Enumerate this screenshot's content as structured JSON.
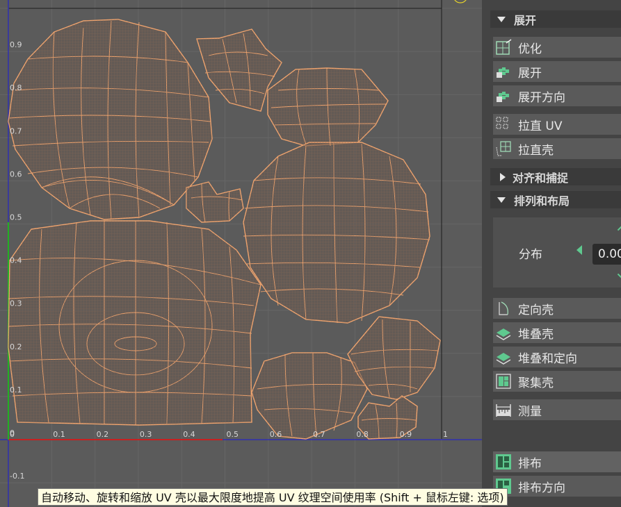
{
  "viewport": {
    "y_ticks": [
      "0.9",
      "0.8",
      "0.7",
      "0.6",
      "0.5",
      "0.4",
      "0.3",
      "0.2",
      "0.1",
      "0",
      "-0.1"
    ],
    "x_ticks": [
      "0",
      "0.1",
      "0.2",
      "0.3",
      "0.4",
      "0.5",
      "0.6",
      "0.7",
      "0.8",
      "0.9",
      "1"
    ],
    "colors": {
      "background": "#5b5b5b",
      "grid": "#6a6a6a",
      "mesh": "#f0a46e",
      "u_axis": "#c82020",
      "v_axis": "#23b023",
      "border": "#2a2aa8"
    }
  },
  "panel": {
    "sections": {
      "unfold": "展开",
      "align_snap": "对齐和捕捉",
      "arrange_layout": "排列和布局"
    },
    "tools": {
      "optimize": "优化",
      "unfold": "展开",
      "unfold_direction": "展开方向",
      "straighten_uv": "拉直 UV",
      "straighten_shell": "拉直壳",
      "distribute_label": "分布",
      "distribute_value": "0.00",
      "orient_shells": "定向壳",
      "stack_shells": "堆叠壳",
      "stack_and_orient": "堆叠和定向",
      "gather_shells": "聚集壳",
      "measure": "测量",
      "layout": "排布",
      "layout_direction": "排布方向"
    }
  },
  "tooltip": "自动移动、旋转和缩放 UV 壳以最大限度地提高 UV 纹理空间使用率 (Shift + 鼠标左键: 选项)"
}
